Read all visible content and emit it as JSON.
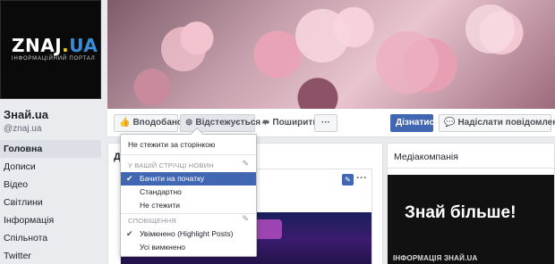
{
  "profile": {
    "logo_main": "ZNAJ",
    "logo_dot": ".",
    "logo_ua": "UA",
    "logo_sub": "ІНФОРМАЦІЙНИЙ ПОРТАЛ",
    "name": "Знай.ua",
    "handle": "@znaj.ua"
  },
  "nav": {
    "items": [
      "Головна",
      "Дописи",
      "Відео",
      "Світлини",
      "Інформація",
      "Спільнота",
      "Twitter"
    ]
  },
  "action_bar": {
    "like": "Вподобано",
    "follow": "Відстежується",
    "share": "Поширити",
    "more": "···",
    "learn": "Дізнатис...",
    "message": "Надіслати повідомлення"
  },
  "main": {
    "heading": "До"
  },
  "right": {
    "title": "Медіакомпанія",
    "promo_big": "Знай більше!",
    "promo_small": "ІНФОРМАЦІЯ ЗНАЙ.UA"
  },
  "dropdown": {
    "unfollow": "Не стежити за сторінкою",
    "feed_section": "У ВАШІЙ СТРІЧЦІ НОВИН",
    "feed_options": [
      "Бачити на початку",
      "Стандартно",
      "Не стежити"
    ],
    "notif_section": "СПОВІЩЕННЯ",
    "notif_options": [
      "Увімкнено (Highlight Posts)",
      "Усі вимкнено"
    ]
  },
  "colors": {
    "accent": "#4267b2",
    "background": "#e9ebee"
  }
}
